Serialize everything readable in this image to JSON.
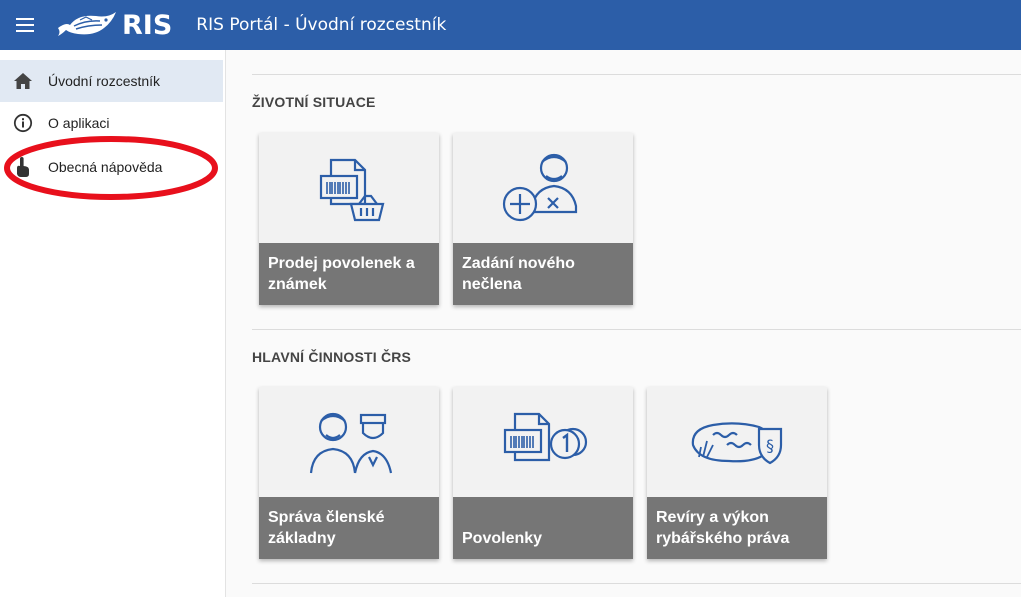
{
  "header": {
    "logo_text": "RIS",
    "title": "RIS Portál - Úvodní rozcestník",
    "color": "#2c5ea8"
  },
  "sidebar": {
    "items": [
      {
        "label": "Úvodní rozcestník",
        "icon": "home-icon",
        "active": true
      },
      {
        "label": "O aplikaci",
        "icon": "info-icon",
        "active": false
      },
      {
        "label": "Obecná nápověda",
        "icon": "touch-help-icon",
        "active": false
      }
    ],
    "annotation_color": "#e8101c"
  },
  "sections": [
    {
      "title": "ŽIVOTNÍ SITUACE",
      "tiles": [
        {
          "label": "Prodej povolenek a známek",
          "icon": "permit-basket-icon"
        },
        {
          "label": "Zadání nového nečlena",
          "icon": "add-person-icon"
        }
      ]
    },
    {
      "title": "HLAVNÍ ČINNOSTI ČRS",
      "tiles": [
        {
          "label": "Správa členské základny",
          "icon": "members-icon"
        },
        {
          "label": "Povolenky",
          "icon": "permit-coin-icon"
        },
        {
          "label": "Revíry a výkon rybářského práva",
          "icon": "fishing-ground-law-icon"
        }
      ]
    }
  ],
  "colors": {
    "accent": "#2c5ea8",
    "tile_label_bg": "#767676",
    "active_item_bg": "#e1e9f3"
  }
}
